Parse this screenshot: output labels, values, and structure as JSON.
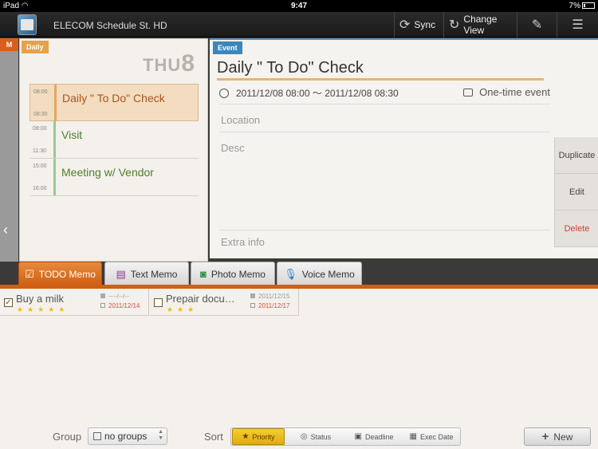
{
  "status_bar": {
    "carrier": "iPad",
    "time": "9:47",
    "battery": "7%"
  },
  "toolbar": {
    "app_title": "ELECOM Schedule St. HD",
    "sync_label": "Sync",
    "change_view_label": "Change View"
  },
  "month_tab": "M",
  "daily": {
    "tab_label": "Daily",
    "day_of_week": "THU",
    "day_number": "8",
    "events": [
      {
        "start": "08:00",
        "end": "08:30",
        "title": "Daily \" To Do\" Check"
      },
      {
        "start": "08:00",
        "end": "11:30",
        "title": "Visit"
      },
      {
        "start": "15:00",
        "end": "16:00",
        "title": "Meeting w/ Vendor"
      }
    ]
  },
  "event": {
    "tab_label": "Event",
    "title": "Daily \" To Do\" Check",
    "time_range": "2011/12/08 08:00 〜 2011/12/08 08:30",
    "recurrence": "One-time event",
    "location_label": "Location",
    "desc_label": "Desc",
    "extra_label": "Extra info",
    "actions": {
      "duplicate": "Duplicate",
      "edit": "Edit",
      "delete": "Delete"
    }
  },
  "memo_tabs": [
    {
      "label": "TODO Memo"
    },
    {
      "label": "Text Memo"
    },
    {
      "label": "Photo Memo"
    },
    {
      "label": "Voice Memo"
    }
  ],
  "todos": [
    {
      "title": "Buy a milk",
      "stars": "★★★★★",
      "start_date": "----/--/--",
      "due_date": "2011/12/14"
    },
    {
      "title": "Prepair docu…",
      "stars": "★★★",
      "start_date": "2011/12/15",
      "due_date": "2011/12/17"
    }
  ],
  "bottom": {
    "group_label": "Group",
    "group_value": "no groups",
    "sort_label": "Sort",
    "sort_options": {
      "priority": "Priority",
      "status": "Status",
      "deadline": "Deadline",
      "exec_date": "Exec Date"
    },
    "new_label": "New"
  }
}
